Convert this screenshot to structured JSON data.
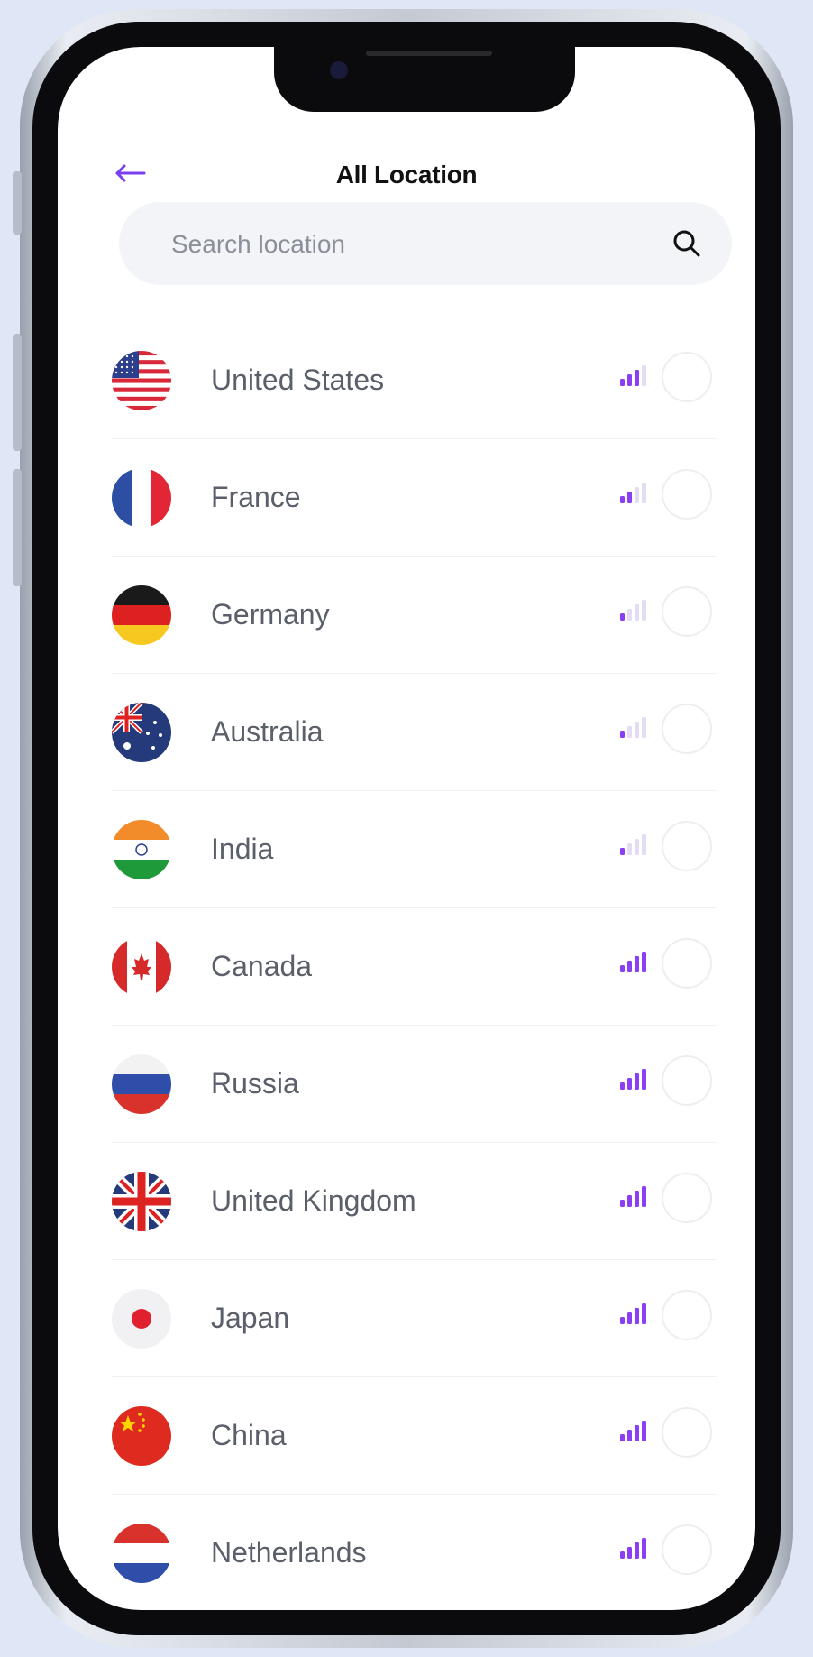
{
  "header": {
    "title": "All Location",
    "back_icon": "arrow-left-icon",
    "accent_color": "#7b3ff2"
  },
  "search": {
    "placeholder": "Search location",
    "value": "",
    "icon": "search-icon"
  },
  "locations": [
    {
      "name": "United States",
      "flag": "us",
      "signal": 3,
      "selected": false
    },
    {
      "name": "France",
      "flag": "fr",
      "signal": 2,
      "selected": false
    },
    {
      "name": "Germany",
      "flag": "de",
      "signal": 1,
      "selected": false
    },
    {
      "name": "Australia",
      "flag": "au",
      "signal": 1,
      "selected": false
    },
    {
      "name": "India",
      "flag": "in",
      "signal": 1,
      "selected": false
    },
    {
      "name": "Canada",
      "flag": "ca",
      "signal": 4,
      "selected": false
    },
    {
      "name": "Russia",
      "flag": "ru",
      "signal": 4,
      "selected": false
    },
    {
      "name": "United Kingdom",
      "flag": "gb",
      "signal": 4,
      "selected": false
    },
    {
      "name": "Japan",
      "flag": "jp",
      "signal": 4,
      "selected": false
    },
    {
      "name": "China",
      "flag": "cn",
      "signal": 4,
      "selected": false
    },
    {
      "name": "Netherlands",
      "flag": "nl",
      "signal": 4,
      "selected": false
    }
  ],
  "signal_colors": {
    "active": "#8a3ff5",
    "inactive": "#e3dcf3"
  }
}
